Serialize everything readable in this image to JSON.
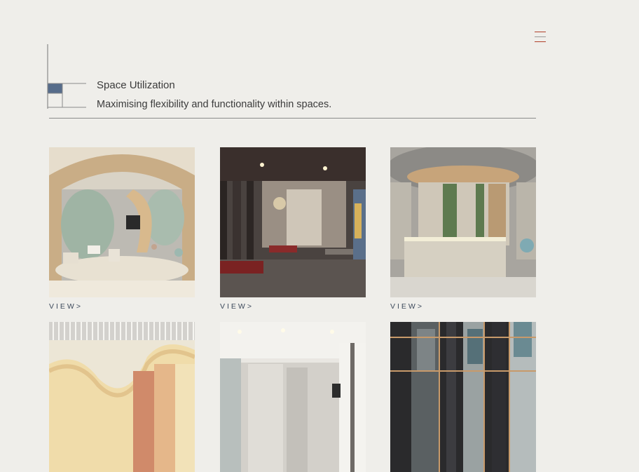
{
  "header": {
    "title": "Space Utilization",
    "subtitle": "Maximising flexibility and functionality within spaces."
  },
  "colors": {
    "background": "#efeeea",
    "accent_blue": "#566c8a",
    "menu_accent": "#b0402a",
    "link_color": "#3d4a5c"
  },
  "cards": [
    {
      "image": "curved-arch-lounge-render",
      "link": "VIEW>"
    },
    {
      "image": "dark-corridor-lounge-render",
      "link": "VIEW>"
    },
    {
      "image": "reception-desk-render",
      "link": "VIEW>"
    },
    {
      "image": "wavy-ceiling-color-block-render"
    },
    {
      "image": "bright-corridor-render"
    },
    {
      "image": "glass-screen-partition-render"
    }
  ],
  "menu": {
    "icon": "hamburger-menu-icon"
  }
}
